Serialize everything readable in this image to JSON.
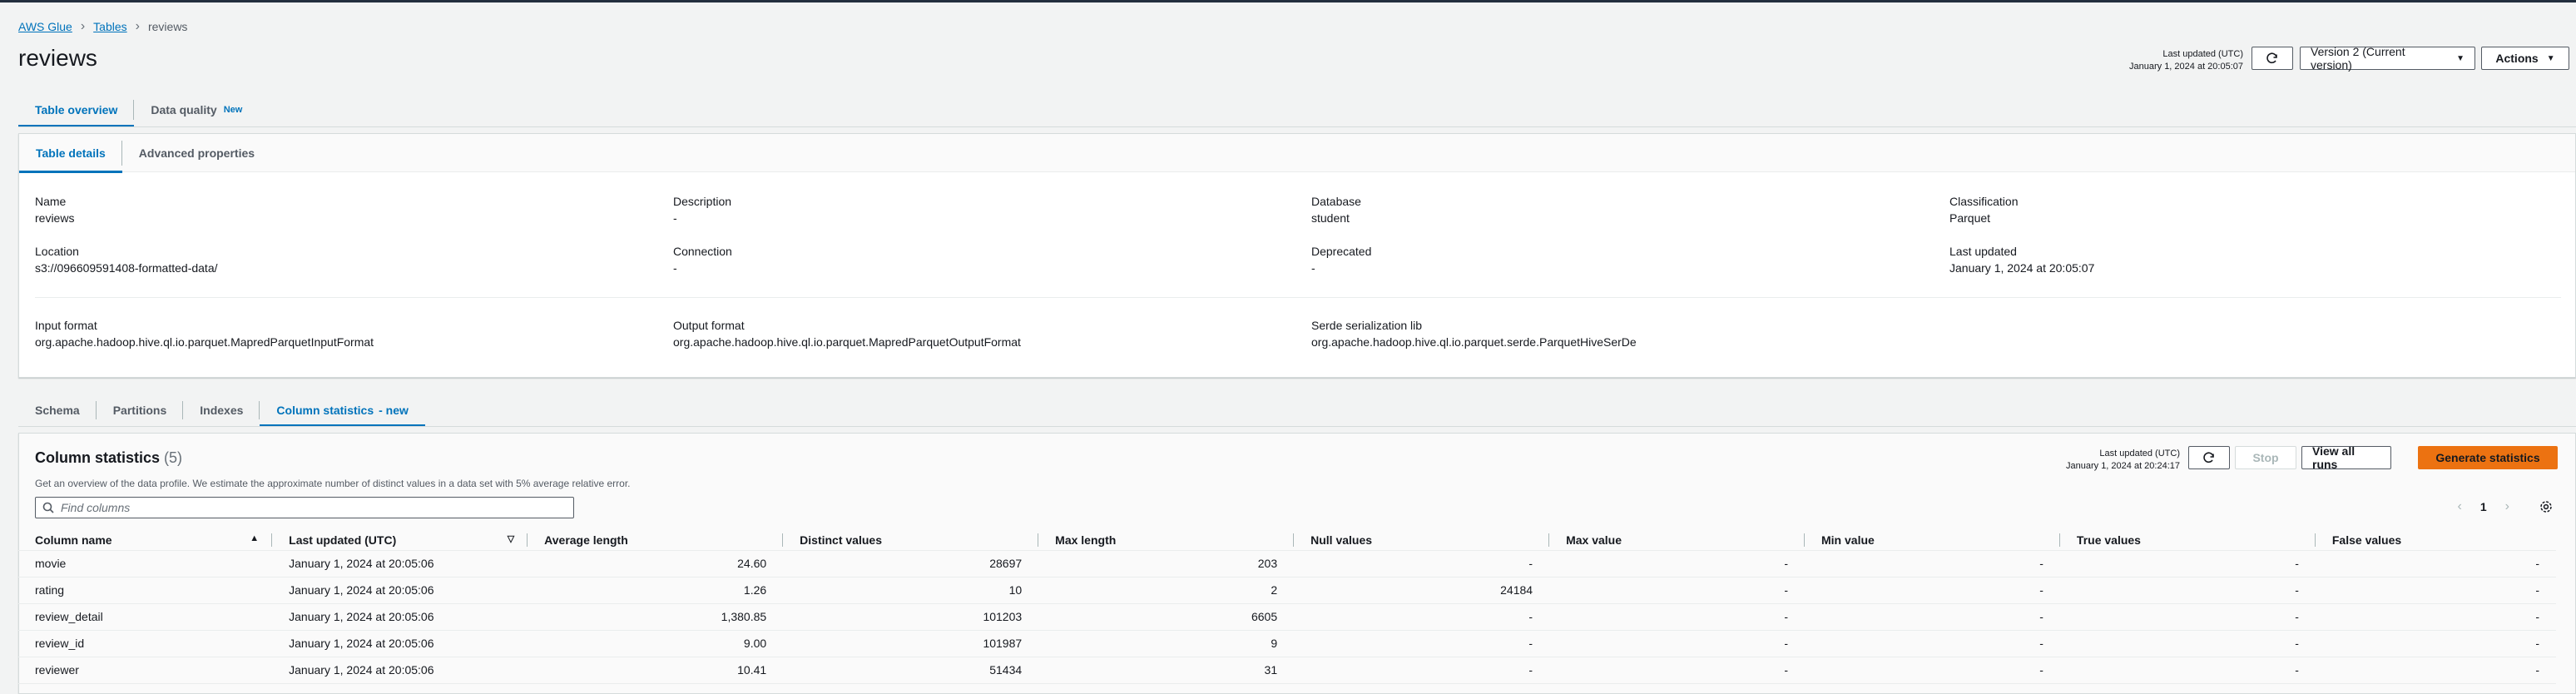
{
  "breadcrumb": {
    "items": [
      "AWS Glue",
      "Tables"
    ],
    "current": "reviews"
  },
  "page": {
    "title": "reviews"
  },
  "header": {
    "last_updated_label": "Last updated (UTC)",
    "last_updated_value": "January 1, 2024 at 20:05:07",
    "version_label": "Version 2 (Current version)",
    "actions_label": "Actions"
  },
  "main_tabs": [
    {
      "label": "Table overview"
    },
    {
      "label": "Data quality",
      "badge": "New"
    }
  ],
  "details_tabs": [
    {
      "label": "Table details"
    },
    {
      "label": "Advanced properties"
    }
  ],
  "details": {
    "name_label": "Name",
    "name": "reviews",
    "description_label": "Description",
    "description": "-",
    "database_label": "Database",
    "database": "student",
    "classification_label": "Classification",
    "classification": "Parquet",
    "location_label": "Location",
    "location": "s3://096609591408-formatted-data/",
    "connection_label": "Connection",
    "connection": "-",
    "deprecated_label": "Deprecated",
    "deprecated": "-",
    "last_updated_label": "Last updated",
    "last_updated": "January 1, 2024 at 20:05:07",
    "input_format_label": "Input format",
    "input_format": "org.apache.hadoop.hive.ql.io.parquet.MapredParquetInputFormat",
    "output_format_label": "Output format",
    "output_format": "org.apache.hadoop.hive.ql.io.parquet.MapredParquetOutputFormat",
    "serde_label": "Serde serialization lib",
    "serde": "org.apache.hadoop.hive.ql.io.parquet.serde.ParquetHiveSerDe"
  },
  "bottom_tabs": [
    {
      "label": "Schema"
    },
    {
      "label": "Partitions"
    },
    {
      "label": "Indexes"
    },
    {
      "label": "Column statistics",
      "badge": "- new"
    }
  ],
  "column_stats": {
    "title": "Column statistics",
    "count": "(5)",
    "description": "Get an overview of the data profile. We estimate the approximate number of distinct values in a data set with 5% average relative error.",
    "last_updated_label": "Last updated (UTC)",
    "last_updated_value": "January 1, 2024 at 20:24:17",
    "stop_label": "Stop",
    "view_all_runs_label": "View all runs",
    "generate_label": "Generate statistics",
    "search_placeholder": "Find columns",
    "page_number": "1",
    "columns": [
      "Column name",
      "Last updated (UTC)",
      "Average length",
      "Distinct values",
      "Max length",
      "Null values",
      "Max value",
      "Min value",
      "True values",
      "False values"
    ],
    "rows": [
      [
        "movie",
        "January 1, 2024 at 20:05:06",
        "24.60",
        "28697",
        "203",
        "-",
        "-",
        "-",
        "-",
        "-"
      ],
      [
        "rating",
        "January 1, 2024 at 20:05:06",
        "1.26",
        "10",
        "2",
        "24184",
        "-",
        "-",
        "-",
        "-"
      ],
      [
        "review_detail",
        "January 1, 2024 at 20:05:06",
        "1,380.85",
        "101203",
        "6605",
        "-",
        "-",
        "-",
        "-",
        "-"
      ],
      [
        "review_id",
        "January 1, 2024 at 20:05:06",
        "9.00",
        "101987",
        "9",
        "-",
        "-",
        "-",
        "-",
        "-"
      ],
      [
        "reviewer",
        "January 1, 2024 at 20:05:06",
        "10.41",
        "51434",
        "31",
        "-",
        "-",
        "-",
        "-",
        "-"
      ]
    ]
  },
  "icons": [
    "chevron-right-icon",
    "refresh-icon",
    "caret-down-icon",
    "search-icon",
    "chevron-left-icon",
    "settings-icon",
    "sort-ascending-icon",
    "sort-icon"
  ],
  "colors": {
    "link": "#0073bb",
    "primary_button": "#ec7211",
    "background": "#f2f3f3",
    "topbar": "#232f3e"
  }
}
